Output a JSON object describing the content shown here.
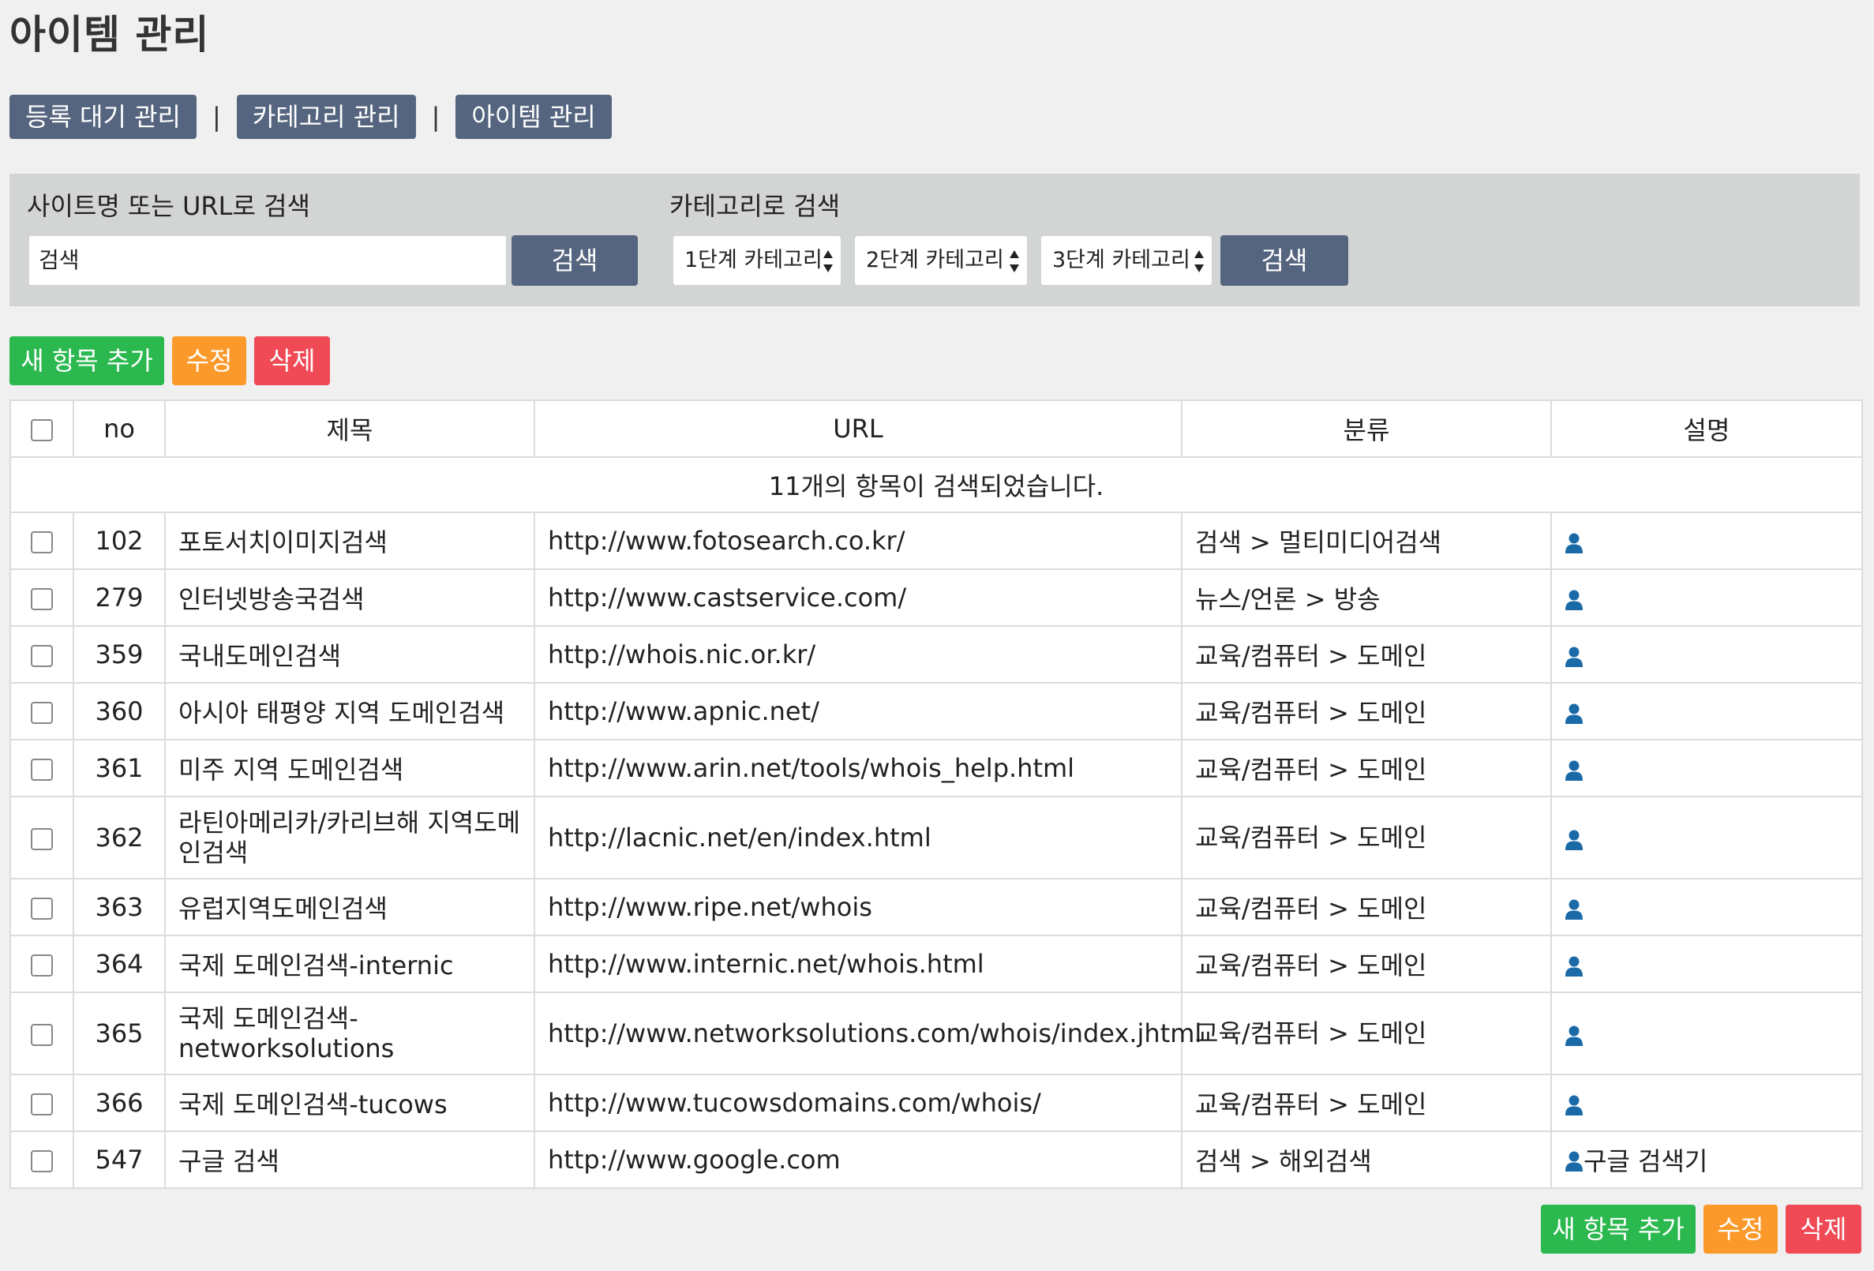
{
  "page_title": "아이템 관리",
  "nav": {
    "buttons": [
      "등록 대기 관리",
      "카테고리 관리",
      "아이템 관리"
    ],
    "separator": "|"
  },
  "search": {
    "site_label": "사이트명 또는 URL로 검색",
    "input_value": "검색",
    "site_button": "검색",
    "category_label": "카테고리로 검색",
    "selects": [
      "1단계 카테고리",
      "2단계 카테고리",
      "3단계 카테고리"
    ],
    "category_button": "검색"
  },
  "actions": {
    "add": "새 항목 추가",
    "edit": "수정",
    "delete": "삭제"
  },
  "table": {
    "headers": [
      "no",
      "제목",
      "URL",
      "분류",
      "설명"
    ],
    "result_message": "11개의 항목이 검색되었습니다.",
    "rows": [
      {
        "no": "102",
        "title": "포토서치이미지검색",
        "url": "http://www.fotosearch.co.kr/",
        "category": "검색 > 멀티미디어검색",
        "desc": ""
      },
      {
        "no": "279",
        "title": "인터넷방송국검색",
        "url": "http://www.castservice.com/",
        "category": "뉴스/언론 > 방송",
        "desc": ""
      },
      {
        "no": "359",
        "title": "국내도메인검색",
        "url": "http://whois.nic.or.kr/",
        "category": "교육/컴퓨터 > 도메인",
        "desc": ""
      },
      {
        "no": "360",
        "title": "아시아 태평양 지역 도메인검색",
        "url": "http://www.apnic.net/",
        "category": "교육/컴퓨터 > 도메인",
        "desc": ""
      },
      {
        "no": "361",
        "title": "미주 지역 도메인검색",
        "url": "http://www.arin.net/tools/whois_help.html",
        "category": "교육/컴퓨터 > 도메인",
        "desc": ""
      },
      {
        "no": "362",
        "title": "라틴아메리카/카리브해 지역도메인검색",
        "url": "http://lacnic.net/en/index.html",
        "category": "교육/컴퓨터 > 도메인",
        "desc": ""
      },
      {
        "no": "363",
        "title": "유럽지역도메인검색",
        "url": "http://www.ripe.net/whois",
        "category": "교육/컴퓨터 > 도메인",
        "desc": ""
      },
      {
        "no": "364",
        "title": "국제 도메인검색-internic",
        "url": "http://www.internic.net/whois.html",
        "category": "교육/컴퓨터 > 도메인",
        "desc": ""
      },
      {
        "no": "365",
        "title": "국제 도메인검색-networksolutions",
        "url": "http://www.networksolutions.com/whois/index.jhtml",
        "category": "교육/컴퓨터 > 도메인",
        "desc": ""
      },
      {
        "no": "366",
        "title": "국제 도메인검색-tucows",
        "url": "http://www.tucowsdomains.com/whois/",
        "category": "교육/컴퓨터 > 도메인",
        "desc": ""
      },
      {
        "no": "547",
        "title": "구글 검색",
        "url": "http://www.google.com",
        "category": "검색 > 해외검색",
        "desc": "구글 검색기"
      }
    ]
  },
  "colors": {
    "nav_button": "#56657f",
    "add_button": "#2bb84f",
    "edit_button": "#fb9a2a",
    "delete_button": "#ef4a55",
    "user_icon": "#1b6aa8"
  },
  "icons": {
    "description_icon": "user-icon"
  }
}
